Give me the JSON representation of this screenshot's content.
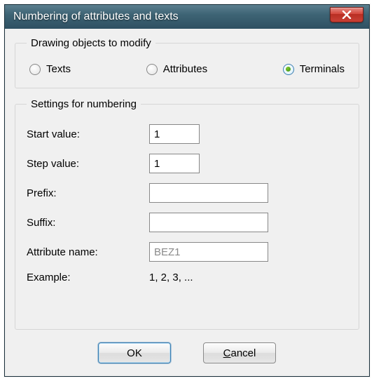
{
  "window": {
    "title": "Numbering of attributes and texts",
    "close_icon": "close"
  },
  "modify_group": {
    "legend": "Drawing objects to modify",
    "options": {
      "texts": {
        "label": "Texts",
        "checked": false
      },
      "attributes": {
        "label": "Attributes",
        "checked": false
      },
      "terminals": {
        "label": "Terminals",
        "checked": true
      }
    }
  },
  "settings_group": {
    "legend": "Settings for numbering",
    "start_value": {
      "label": "Start value:",
      "value": "1"
    },
    "step_value": {
      "label": "Step value:",
      "value": "1"
    },
    "prefix": {
      "label": "Prefix:",
      "value": ""
    },
    "suffix": {
      "label": "Suffix:",
      "value": ""
    },
    "attribute_name": {
      "label": "Attribute name:",
      "value": "BEZ1",
      "disabled": true
    },
    "example": {
      "label": "Example:",
      "value": "1, 2, 3, ..."
    }
  },
  "buttons": {
    "ok": "OK",
    "cancel_prefix": "C",
    "cancel_rest": "ancel"
  }
}
